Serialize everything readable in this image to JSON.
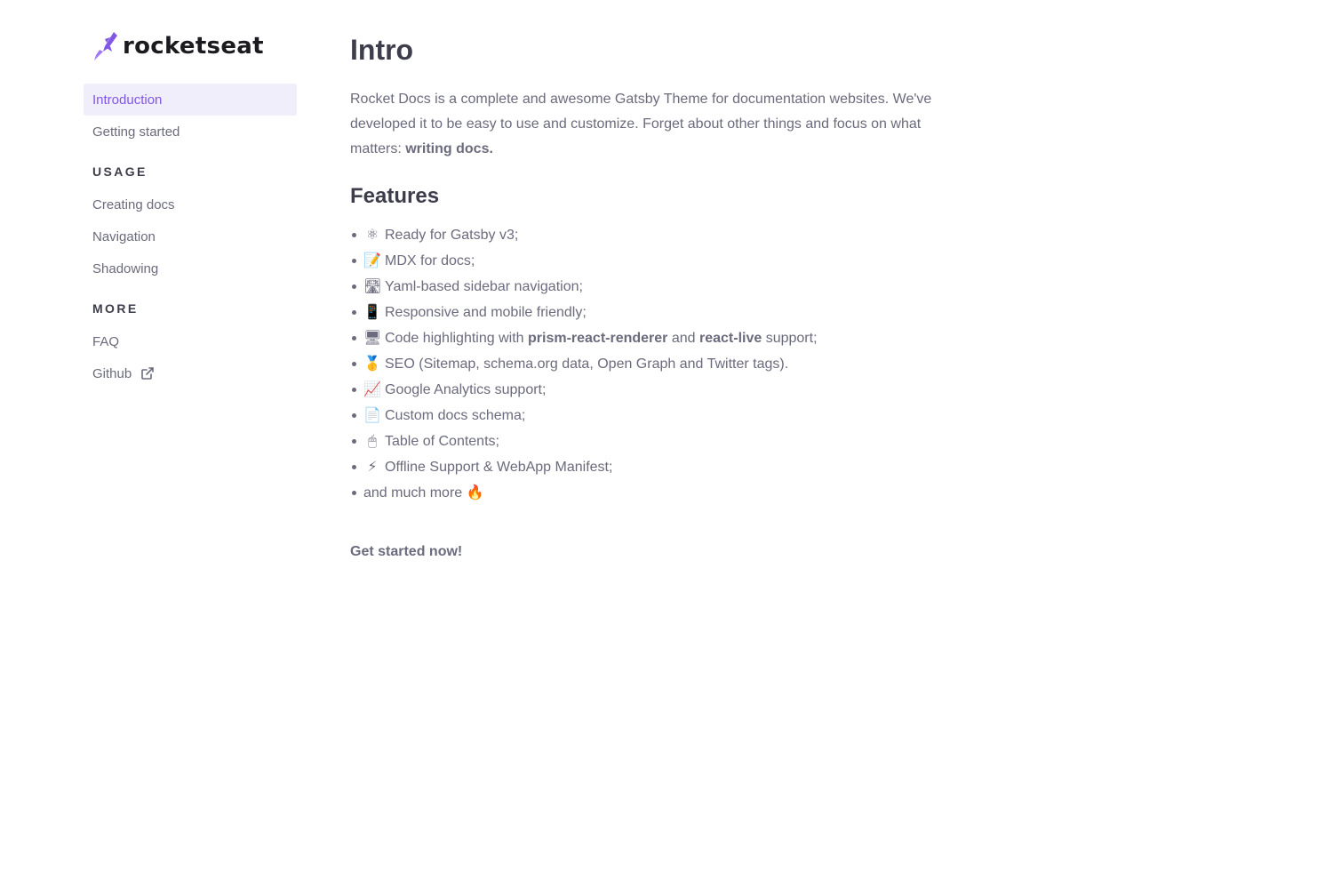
{
  "brand": {
    "name": "rocketseat",
    "accent": "#8257e6"
  },
  "sidebar": {
    "top_items": [
      {
        "label": "Introduction",
        "active": true
      },
      {
        "label": "Getting started",
        "active": false
      }
    ],
    "sections": [
      {
        "title": "USAGE",
        "items": [
          {
            "label": "Creating docs"
          },
          {
            "label": "Navigation"
          },
          {
            "label": "Shadowing"
          }
        ]
      },
      {
        "title": "MORE",
        "items": [
          {
            "label": "FAQ"
          },
          {
            "label": "Github",
            "icon": "external-link-icon"
          }
        ]
      }
    ]
  },
  "main": {
    "title": "Intro",
    "intro_text": "Rocket Docs is a complete and awesome Gatsby Theme for documentation websites. We've developed it to be easy to use and customize. Forget about other things and focus on what matters: ",
    "intro_bold": "writing docs.",
    "features_title": "Features",
    "features": [
      {
        "emoji": "⚛",
        "icon": "atom-icon",
        "text": "Ready for Gatsby v3;"
      },
      {
        "emoji": "📝",
        "icon": "memo-icon",
        "text": "MDX for docs;"
      },
      {
        "emoji": "🛣",
        "icon": "road-icon",
        "text": "Yaml-based sidebar navigation;"
      },
      {
        "emoji": "📱",
        "icon": "mobile-phone-icon",
        "text": "Responsive and mobile friendly;"
      },
      {
        "emoji": "🖥",
        "icon": "desktop-computer-icon",
        "text_before": "Code highlighting with ",
        "bold1": "prism-react-renderer",
        "text_mid": " and ",
        "bold2": "react-live",
        "text_after": " support;"
      },
      {
        "emoji": "🥇",
        "icon": "gold-medal-icon",
        "text": "SEO (Sitemap, schema.org data, Open Graph and Twitter tags)."
      },
      {
        "emoji": "📈",
        "icon": "chart-increasing-icon",
        "text": "Google Analytics support;"
      },
      {
        "emoji": "📄",
        "icon": "document-icon",
        "text": "Custom docs schema;"
      },
      {
        "emoji": "🖱",
        "icon": "mouse-icon",
        "text": "Table of Contents;"
      },
      {
        "emoji": "⚡",
        "icon": "lightning-icon",
        "text": "Offline Support & WebApp Manifest;"
      },
      {
        "emoji": "🔥",
        "icon": "fire-icon",
        "text": "and much more",
        "emoji_after": true
      }
    ],
    "cta": "Get started now!"
  }
}
